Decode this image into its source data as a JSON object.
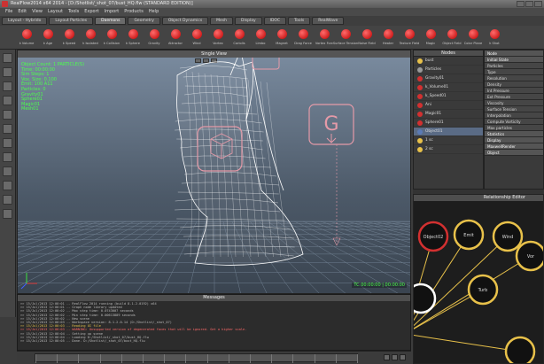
{
  "window": {
    "title": "RealFlow2014 x64 2014 - [D:/Shotlist/_shot_07/bust_HQ.flw (STANDARD EDITION)]"
  },
  "menu": [
    "File",
    "Edit",
    "View",
    "Layout",
    "Tools",
    "Export",
    "Import",
    "Products",
    "Help"
  ],
  "shelf_tabs": [
    {
      "label": "Layout - Hybrido",
      "active": false
    },
    {
      "label": "Layout Particles",
      "active": false
    },
    {
      "label": "Daemons",
      "active": true
    },
    {
      "label": "Geometry",
      "active": false
    },
    {
      "label": "Object Dynamics",
      "active": false
    },
    {
      "label": "Mesh",
      "active": false
    },
    {
      "label": "Display",
      "active": false
    },
    {
      "label": "IDOC",
      "active": false
    },
    {
      "label": "Tools",
      "active": false
    },
    {
      "label": "RealWave",
      "active": false
    }
  ],
  "shelf_tools": [
    "k Volume",
    "k Age",
    "k Speed",
    "k Isolated",
    "k Collision",
    "k Sphere",
    "Gravity",
    "Attractor",
    "Wind",
    "Vortex",
    "Coriolis",
    "Limbo",
    "Magnet",
    "Drag Force",
    "Vortex Forc",
    "Surface Tension",
    "Noise Field",
    "Heater",
    "Texture Field",
    "Magic",
    "Object Field",
    "Color Plane",
    "k Shot"
  ],
  "left_tools": [
    "select",
    "move",
    "rotate",
    "scale",
    "camera",
    "light",
    "render",
    "sim",
    "play",
    "stop",
    "export",
    "save"
  ],
  "viewport": {
    "title": "Single View",
    "stats": [
      "Object Count: 1 PARTICLE(S)",
      "Time: 00:00:00",
      "Sim Steps: 1",
      "Vox. Size: 0.100",
      "Emit: 100 A11",
      "Particles: 0",
      "Gravity01",
      "Sphere01",
      "Magic01",
      "Mesh01"
    ],
    "gizmo_letter": "G",
    "timecode": "TC 00:00:00 | 00:00:00",
    "grid_color": "#6f7f90",
    "mesh_color": "#ffffff",
    "gizmo_color": "#e59aa8"
  },
  "messages": {
    "title": "Messages",
    "lines": [
      {
        "t": ">> 15/Jul/2013 12:00:01 -- RealFlow 2014 running (build 8.1.2.0192) x64",
        "c": ""
      },
      {
        "t": ">> 15/Jul/2013 12:00:01 -- Graph node library updated",
        "c": ""
      },
      {
        "t": ">> 15/Jul/2013 12:00:02 -- Max step time: 0.0743007 seconds",
        "c": ""
      },
      {
        "t": ">> 15/Jul/2013 12:00:02 -- Min step time: 0.00613889 seconds",
        "c": ""
      },
      {
        "t": ">> 15/Jul/2013 12:00:02 -- New scene",
        "c": ""
      },
      {
        "t": ">> 15/Jul/2013 12:00:03 -- Workspace version: 8.1.2.0.14 (D:/Shotlist/_shot_07)",
        "c": ""
      },
      {
        "t": ">> 15/Jul/2013 12:00:03 -- Reading UI file",
        "c": "warn"
      },
      {
        "t": ">> 15/Jul/2013 12:00:03 -- WARNING: Unsupported version of degenerated faces that will be ignored. Get a higher scale.",
        "c": "err"
      },
      {
        "t": ">> 15/Jul/2013 12:00:04 -- Setting up scene",
        "c": ""
      },
      {
        "t": ">> 15/Jul/2013 12:00:04 -- Loading D:/Shotlist/_shot_07/bust_HQ.flw",
        "c": ""
      },
      {
        "t": ">> 15/Jul/2013 12:00:05 -- Done. D:/Shotlist/_shot_07/bust_HQ.flw",
        "c": ""
      }
    ]
  },
  "timeline": {
    "ticks": 16
  },
  "nodes": {
    "title": "Nodes",
    "items": [
      {
        "label": "bust",
        "color": "#e8c14a",
        "selected": false
      },
      {
        "label": "Particles",
        "color": "#9a9a9a",
        "selected": false
      },
      {
        "label": "Gravity01",
        "color": "#d23030",
        "selected": false
      },
      {
        "label": "k_Volume01",
        "color": "#d23030",
        "selected": false
      },
      {
        "label": "k_Speed01",
        "color": "#d23030",
        "selected": false
      },
      {
        "label": "Ani",
        "color": "#d23030",
        "selected": false
      },
      {
        "label": "Magic01",
        "color": "#d23030",
        "selected": false
      },
      {
        "label": "Sphere01",
        "color": "#d23030",
        "selected": false
      },
      {
        "label": "Object01",
        "color": "#5a7ab5",
        "selected": true
      },
      {
        "label": "1 sc",
        "color": "#e8c14a",
        "selected": false
      },
      {
        "label": "2 sc",
        "color": "#e8c14a",
        "selected": false
      }
    ]
  },
  "properties": {
    "rows": [
      {
        "label": "Node",
        "hd": true
      },
      {
        "label": "Initial State",
        "hd": true
      },
      {
        "label": "Particles",
        "hd": false
      },
      {
        "label": "Type",
        "hd": false
      },
      {
        "label": "Resolution",
        "hd": false
      },
      {
        "label": "Density",
        "hd": false
      },
      {
        "label": "Int Pressure",
        "hd": false
      },
      {
        "label": "Ext Pressure",
        "hd": false
      },
      {
        "label": "Viscosity",
        "hd": false
      },
      {
        "label": "Surface Tension",
        "hd": false
      },
      {
        "label": "Interpolation",
        "hd": false
      },
      {
        "label": "Compute Vorticity",
        "hd": false
      },
      {
        "label": "Max particles",
        "hd": false
      },
      {
        "label": "Statistics",
        "hd": true
      },
      {
        "label": "Display",
        "hd": true
      },
      {
        "label": "MaxwellRender",
        "hd": true
      },
      {
        "label": "Object",
        "hd": true
      }
    ]
  },
  "relationship": {
    "title": "Relationship Editor",
    "nodes": [
      {
        "label": "Object02",
        "ring": "#d23030"
      },
      {
        "label": "Emit",
        "ring": "#e8c14a"
      },
      {
        "label": "Wind",
        "ring": "#e8c14a"
      },
      {
        "label": "Vor",
        "ring": "#e8c14a"
      },
      {
        "label": "Turb",
        "ring": "#e8c14a"
      },
      {
        "label": "",
        "ring": "#ffffff"
      },
      {
        "label": "",
        "ring": "#e8c14a"
      }
    ],
    "link_color": "#e8c14a"
  }
}
